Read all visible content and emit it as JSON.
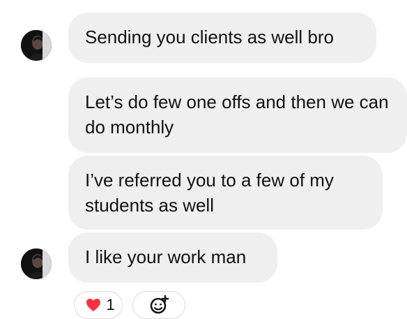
{
  "messages": [
    {
      "text": "Sending you clients as well bro"
    },
    {
      "text": "Let’s do few one offs and then we can do monthly"
    },
    {
      "text": "I’ve referred you to a few of my students as well"
    },
    {
      "text": "I like your work man"
    }
  ],
  "reactions": {
    "count": "1",
    "emoji": "heart-icon",
    "add_icon": "add-reaction-icon"
  },
  "colors": {
    "bubble": "#efefef",
    "heart": "#ff3040",
    "text": "#111111"
  }
}
